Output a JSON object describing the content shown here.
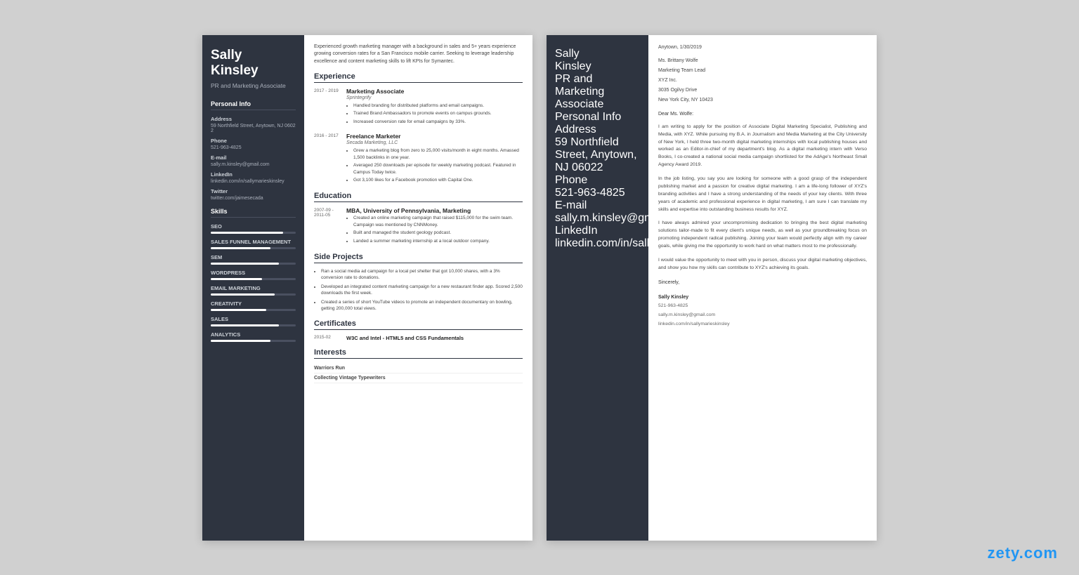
{
  "resume": {
    "name_line1": "Sally",
    "name_line2": "Kinsley",
    "job_title": "PR and Marketing Associate",
    "summary": "Experienced growth marketing manager with a background in sales and 5+ years experience growing conversion rates for a San Francisco mobile carrier. Seeking to leverage leadership excellence and content marketing skills to lift KPIs for Symantec.",
    "sidebar": {
      "personal_info_title": "Personal Info",
      "address_label": "Address",
      "address_value": "59 Northfield Street, Anytown, NJ 06022",
      "phone_label": "Phone",
      "phone_value": "521-963-4825",
      "email_label": "E-mail",
      "email_value": "sally.m.kinsley@gmail.com",
      "linkedin_label": "LinkedIn",
      "linkedin_value": "linkedin.com/in/sallymarieskinsley",
      "twitter_label": "Twitter",
      "twitter_value": "twitter.com/jaimesecada",
      "skills_title": "Skills",
      "skills": [
        {
          "name": "SEO",
          "pct": 85
        },
        {
          "name": "SALES FUNNEL MANAGEMENT",
          "pct": 70
        },
        {
          "name": "SEM",
          "pct": 80
        },
        {
          "name": "WORDPRESS",
          "pct": 60
        },
        {
          "name": "EMAIL MARKETING",
          "pct": 75
        },
        {
          "name": "CREATIVITY",
          "pct": 65
        },
        {
          "name": "SALES",
          "pct": 80
        },
        {
          "name": "ANALYTICS",
          "pct": 70
        }
      ]
    },
    "sections": {
      "experience_title": "Experience",
      "jobs": [
        {
          "date": "2017 - 2019",
          "title": "Marketing Associate",
          "company": "Sprintegrify",
          "bullets": [
            "Handled branding for distributed platforms and email campaigns.",
            "Trained Brand Ambassadors to promote events on campus grounds.",
            "Increased conversion rate for email campaigns by 33%."
          ]
        },
        {
          "date": "2016 - 2017",
          "title": "Freelance Marketer",
          "company": "Secada Marketing, LLC",
          "bullets": [
            "Grew a marketing blog from zero to 25,000 visits/month in eight months. Amassed 1,500 backlinks in one year.",
            "Averaged 250 downloads per episode for weekly marketing podcast. Featured in Campus Today twice.",
            "Got 3,100 likes for a Facebook promotion with Capital One."
          ]
        }
      ],
      "education_title": "Education",
      "education": [
        {
          "date": "2007-09 - 2011-05",
          "title": "MBA, University of Pennsylvania, Marketing",
          "bullets": [
            "Created an online marketing campaign that raised $115,000 for the swim team. Campaign was mentioned by CNNMoney.",
            "Built and managed the student geology podcast.",
            "Landed a summer marketing internship at a local outdoor company."
          ]
        }
      ],
      "side_projects_title": "Side Projects",
      "side_projects": [
        "Ran a social media ad campaign for a local pet shelter that got 10,000 shares, with a 3% conversion rate to donations.",
        "Developed an integrated content marketing campaign for a new restaurant finder app. Scored 2,500 downloads the first week.",
        "Created a series of short YouTube videos to promote an independent documentary on bowling, getting 200,000 total views."
      ],
      "certificates_title": "Certificates",
      "certificates": [
        {
          "date": "2015-02",
          "name": "W3C and Intel - HTML5 and CSS Fundamentals"
        }
      ],
      "interests_title": "Interests",
      "interests": [
        "Warriors Run",
        "Collecting Vintage Typewriters"
      ]
    }
  },
  "cover": {
    "name_line1": "Sally",
    "name_line2": "Kinsley",
    "job_title": "PR and Marketing Associate",
    "sidebar": {
      "personal_info_title": "Personal Info",
      "address_label": "Address",
      "address_value": "59 Northfield Street, Anytown, NJ 06022",
      "phone_label": "Phone",
      "phone_value": "521-963-4825",
      "email_label": "E-mail",
      "email_value": "sally.m.kinsley@gmail.com",
      "linkedin_label": "LinkedIn",
      "linkedin_value": "linkedin.com/in/sallymarieskinsley"
    },
    "content": {
      "date": "Anytown, 1/30/2019",
      "recipient_name": "Ms. Brittany Wolfe",
      "recipient_title": "Marketing Team Lead",
      "company": "XYZ Inc.",
      "address": "3035 Ogilvy Drive",
      "city_state": "New York City, NY 10423",
      "greeting": "Dear Ms. Wolfe:",
      "paragraphs": [
        "I am writing to apply for the position of Associate Digital Marketing Specialist, Publishing and Media, with XYZ. While pursuing my B.A. in Journalism and Media Marketing at the City University of New York, I held three two-month digital marketing internships with local publishing houses and worked as an Editor-in-chief of my department's blog. As a digital marketing intern with Verso Books, I co-created a national social media campaign shortlisted for the AdAge's Northeast Small Agency Award 2019.",
        "In the job listing, you say you are looking for someone with a good grasp of the independent publishing market and a passion for creative digital marketing. I am a life-long follower of XYZ's branding activities and I have a strong understanding of the needs of your key clients. With three years of academic and professional experience in digital marketing, I am sure I can translate my skills and expertise into outstanding business results for XYZ.",
        "I have always admired your uncompromising dedication to bringing the best digital marketing solutions tailor-made to fit every client's unique needs, as well as your groundbreaking focus on promoting independent radical publishing. Joining your team would perfectly align with my career goals, while giving me the opportunity to work hard on what matters most to me professionally.",
        "I would value the opportunity to meet with you in person, discuss your digital marketing objectives, and show you how my skills can contribute to XYZ's achieving its goals."
      ],
      "closing": "Sincerely,",
      "sig_name": "Sally Kinsley",
      "sig_phone": "521-963-4825",
      "sig_email": "sally.m.kinsley@gmail.com",
      "sig_linkedin": "linkedin.com/in/sallymarieskinsley"
    }
  },
  "brand": {
    "zety_label": "zety.com"
  }
}
